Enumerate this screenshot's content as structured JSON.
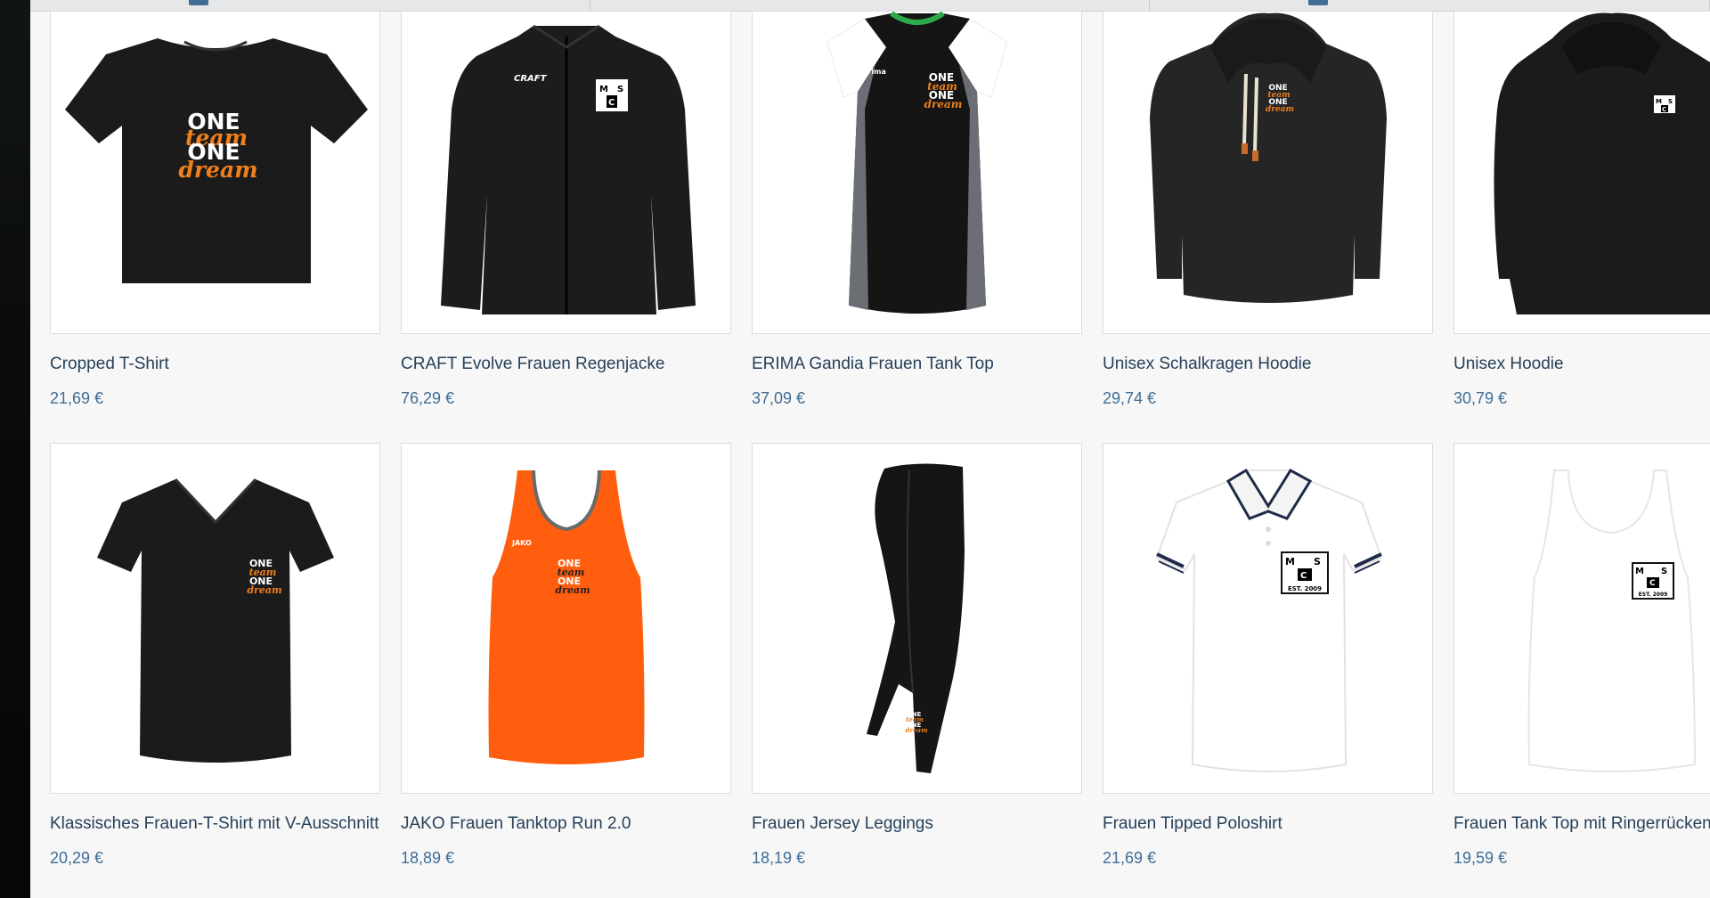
{
  "products": [
    {
      "name": "Cropped T-Shirt",
      "price": "21,69 €",
      "print": [
        "ONE",
        "team",
        "ONE",
        "dream"
      ]
    },
    {
      "name": "CRAFT Evolve Frauen Regenjacke",
      "price": "76,29 €",
      "print": [
        "CRAFT",
        "M",
        "S",
        "C"
      ]
    },
    {
      "name": "ERIMA Gandia Frauen Tank Top",
      "price": "37,09 €",
      "print": [
        "erima",
        "ONE",
        "team",
        "ONE",
        "dream"
      ]
    },
    {
      "name": "Unisex Schalkragen Hoodie",
      "price": "29,74 €",
      "print": [
        "ONE",
        "team",
        "ONE",
        "dream"
      ]
    },
    {
      "name": "Unisex Hoodie",
      "price": "30,79 €",
      "print": [
        "M",
        "S",
        "C"
      ]
    },
    {
      "name": "Klassisches Frauen-T-Shirt mit V-Ausschnitt",
      "price": "20,29 €",
      "print": [
        "ONE",
        "team",
        "ONE",
        "dream"
      ]
    },
    {
      "name": "JAKO Frauen Tanktop Run 2.0",
      "price": "18,89 €",
      "print": [
        "JAKO",
        "ONE",
        "team",
        "ONE",
        "dream"
      ]
    },
    {
      "name": "Frauen Jersey Leggings",
      "price": "18,19 €",
      "print": [
        "ONE",
        "team",
        "ONE",
        "dream"
      ]
    },
    {
      "name": "Frauen Tipped Poloshirt",
      "price": "21,69 €",
      "print": [
        "M",
        "S",
        "C",
        "EST. 2009"
      ]
    },
    {
      "name": "Frauen Tank Top mit Ringerrücken",
      "price": "19,59 €",
      "print": [
        "M",
        "S",
        "C",
        "EST. 2009"
      ]
    }
  ],
  "colors": {
    "title": "#27405a",
    "price": "#3f6d96",
    "orange": "#f07f1d",
    "garment_black": "#1b1b1b",
    "garment_orange": "#ff5e0e"
  }
}
